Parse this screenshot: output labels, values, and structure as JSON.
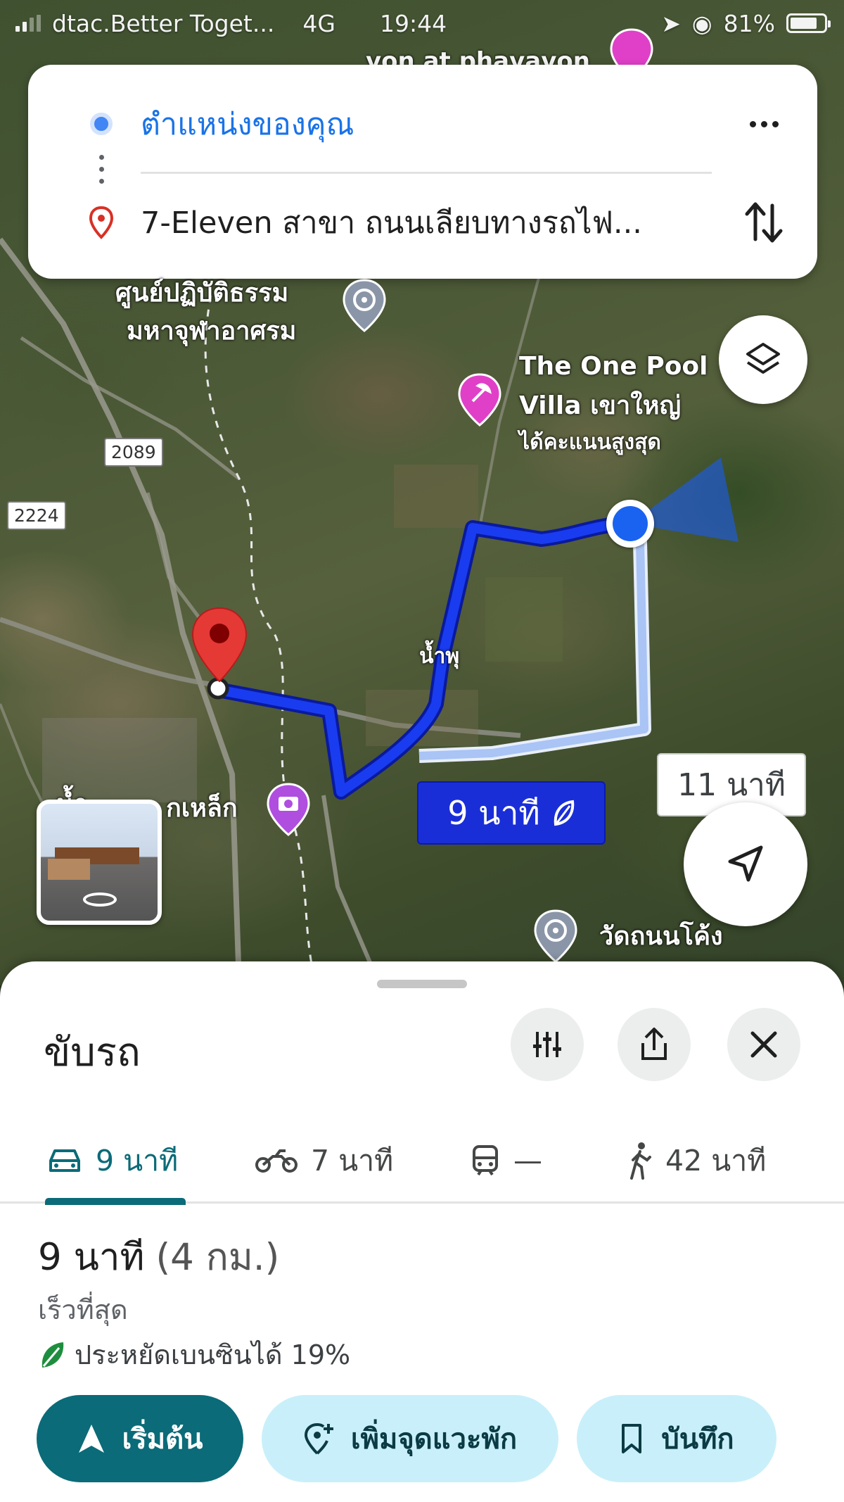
{
  "status_bar": {
    "carrier": "dtac.Better Toget...",
    "network": "4G",
    "time": "19:44",
    "battery": "81%",
    "battery_level": 0.81
  },
  "directions": {
    "origin": "ตำแหน่งของคุณ",
    "destination": "7-Eleven สาขา ถนนเลียบทางรถไฟ...",
    "origin_color": "#4285f4",
    "destination_pin_color": "#d93025"
  },
  "map": {
    "labels": {
      "top_cut": "von at phavavon",
      "dharma_center_line1": "ศูนย์ปฏิบัติธรรม",
      "dharma_center_line2": "มหาจุฬาอาศรม",
      "pool_villa_line1": "The One Pool",
      "pool_villa_line2": "Villa เขาใหญ่",
      "pool_villa_line3": "ได้คะแนนสูงสุด",
      "nam_phu": "น้ำพุ",
      "lek_place": "กเหล็ก",
      "lek_prefix": "น้ำ",
      "wat_label": "วัดถนนโค้ง"
    },
    "shields": {
      "road_a": "2089",
      "road_b": "2224"
    },
    "eta_primary": "9 นาที",
    "eta_alternative": "11 นาที",
    "route_color": "#1a2ed8",
    "alt_route_color": "#a9c4f5"
  },
  "sheet": {
    "title": "ขับรถ",
    "tabs": [
      {
        "mode": "car-icon",
        "label": "9 นาที"
      },
      {
        "mode": "motorcycle-icon",
        "label": "7 นาที"
      },
      {
        "mode": "transit-icon",
        "label": "—"
      },
      {
        "mode": "walk-icon",
        "label": "42 นาที"
      }
    ],
    "route_time": "9 นาที",
    "route_distance": "(4 กม.)",
    "route_note": "เร็วที่สุด",
    "fuel_saving": "ประหยัดเบนซินได้ 19%",
    "buttons": {
      "start": "เริ่มต้น",
      "add_stop": "เพิ่มจุดแวะพัก",
      "save": "บันทึก"
    },
    "accent_color": "#0b6b78"
  }
}
